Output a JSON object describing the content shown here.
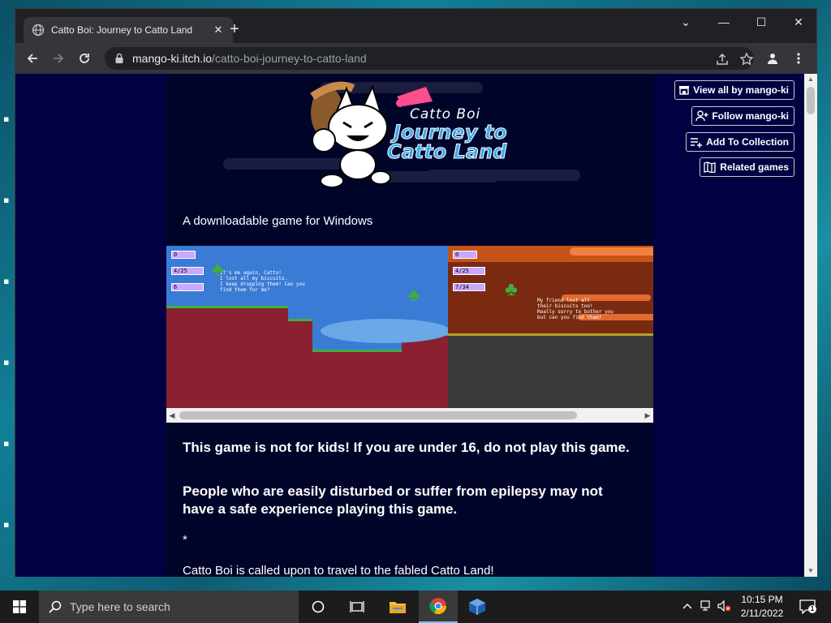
{
  "browser": {
    "tab_title": "Catto Boi: Journey to Catto Land",
    "tab_close": "✕",
    "new_tab": "+",
    "url_host": "mango-ki.itch.io",
    "url_path": "/catto-boi-journey-to-catto-land"
  },
  "window_controls": {
    "collapse": "⌄",
    "minimize": "—",
    "maximize": "☐",
    "close": "✕"
  },
  "page": {
    "logo_line1": "Catto Boi",
    "logo_line2": "Journey to",
    "logo_line3": "Catto Land",
    "tagline": "A downloadable game for Windows",
    "warning_1": "This game is not for kids! If you are under 16, do not play this game.",
    "warning_2": "People who are easily disturbed or suffer from epilepsy may not have a safe experience playing this game.",
    "asterisk": "*",
    "intro": "Catto Boi is called upon to travel to the fabled Catto Land!"
  },
  "screenshots": {
    "shot1_dialog": "It's me again, Catto!\nI lost all my biscuits.\nI keep dropping them! Can you\nfind them for me?",
    "shot2_dialog": "My friend lost all\ntheir biscuits too!\nReally sorry to bother you\nbut can you find them?",
    "shot1_hud": [
      "0",
      "4/25",
      "6"
    ],
    "shot2_hud": [
      "0",
      "4/25",
      "7/34"
    ]
  },
  "sidebar_buttons": {
    "view_all": "View all by mango-ki",
    "follow": "Follow mango-ki",
    "add_collection": "Add To Collection",
    "related": "Related games"
  },
  "taskbar": {
    "search_placeholder": "Type here to search",
    "time": "10:15 PM",
    "date": "2/11/2022",
    "notification_count": "1"
  },
  "colors": {
    "page_bg": "#010042",
    "column_bg": "#010429",
    "logo_blue": "#38a8f0",
    "logo_pink": "#ff4d8d"
  }
}
